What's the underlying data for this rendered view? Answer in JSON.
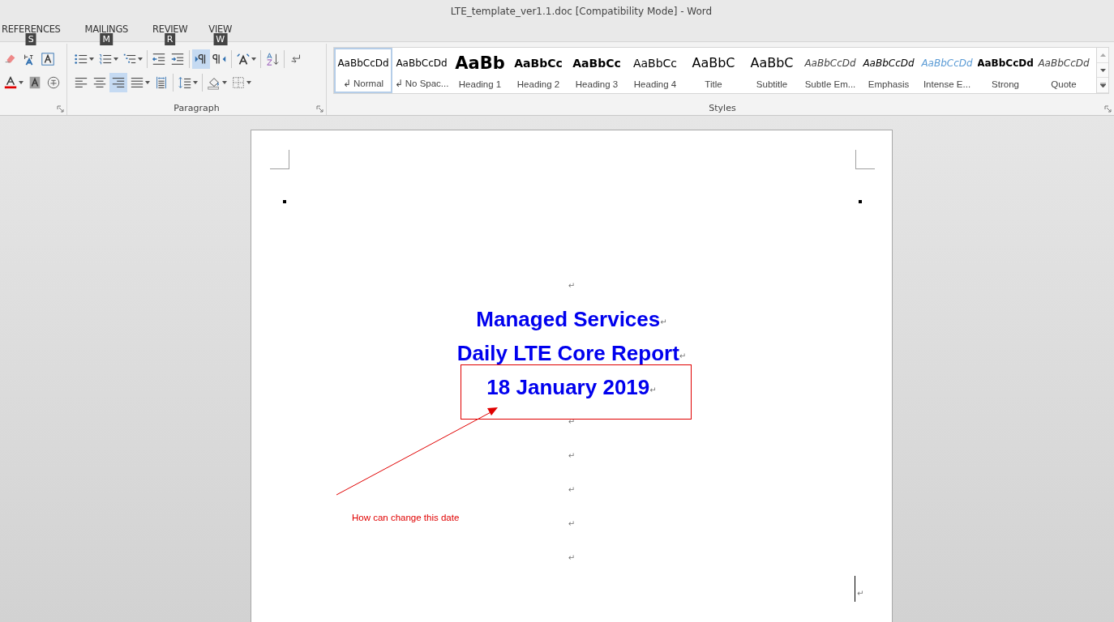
{
  "window": {
    "title": "LTE_template_ver1.1.doc [Compatibility Mode] - Word"
  },
  "tabs": [
    {
      "label": "REFERENCES",
      "keytip": "S"
    },
    {
      "label": "MAILINGS",
      "keytip": "M"
    },
    {
      "label": "REVIEW",
      "keytip": "R"
    },
    {
      "label": "VIEW",
      "keytip": "W"
    }
  ],
  "font_group": {
    "rows": [
      [
        {
          "kind": "clear-format",
          "selected": false,
          "caret": false
        },
        {
          "kind": "phonetic",
          "selected": false,
          "caret": false
        },
        {
          "kind": "char-border",
          "selected": false,
          "caret": false
        }
      ],
      [
        {
          "kind": "font-color",
          "selected": false,
          "caret": true
        },
        {
          "kind": "char-shading",
          "selected": false,
          "caret": false
        },
        {
          "kind": "enclose",
          "selected": false,
          "caret": false
        }
      ]
    ]
  },
  "paragraph_group": {
    "label": "Paragraph",
    "rows": [
      [
        {
          "kind": "bullets",
          "selected": false,
          "caret": true
        },
        {
          "kind": "numbering",
          "selected": false,
          "caret": true
        },
        {
          "kind": "multilevel",
          "selected": false,
          "caret": true
        },
        {
          "kind": "sep"
        },
        {
          "kind": "outdent",
          "selected": false,
          "caret": false
        },
        {
          "kind": "indent",
          "selected": false,
          "caret": false
        },
        {
          "kind": "sep"
        },
        {
          "kind": "ltr",
          "selected": true,
          "caret": false
        },
        {
          "kind": "rtl",
          "selected": false,
          "caret": false
        },
        {
          "kind": "sep"
        },
        {
          "kind": "asian-layout",
          "selected": false,
          "caret": true
        },
        {
          "kind": "sep"
        },
        {
          "kind": "sort",
          "selected": false,
          "caret": false
        },
        {
          "kind": "sep"
        },
        {
          "kind": "show-marks",
          "selected": false,
          "caret": false
        }
      ],
      [
        {
          "kind": "align-left",
          "selected": false,
          "caret": false
        },
        {
          "kind": "align-center",
          "selected": false,
          "caret": false
        },
        {
          "kind": "align-right",
          "selected": true,
          "caret": false
        },
        {
          "kind": "justify",
          "selected": false,
          "caret": true
        },
        {
          "kind": "distributed",
          "selected": false,
          "caret": false
        },
        {
          "kind": "sep"
        },
        {
          "kind": "line-spacing",
          "selected": false,
          "caret": true
        },
        {
          "kind": "sep"
        },
        {
          "kind": "shading",
          "selected": false,
          "caret": true
        },
        {
          "kind": "borders",
          "selected": false,
          "caret": true
        }
      ]
    ]
  },
  "styles_group": {
    "label": "Styles",
    "items": [
      {
        "preview": "AaBbCcDd",
        "label": "Normal",
        "mark": "↲",
        "kind": "normal",
        "selected": true
      },
      {
        "preview": "AaBbCcDd",
        "label": "No Spac...",
        "mark": "↲",
        "kind": "normal",
        "selected": false
      },
      {
        "preview": "AaBb",
        "label": "Heading 1",
        "kind": "h1",
        "selected": false
      },
      {
        "preview": "AaBbCc",
        "label": "Heading 2",
        "kind": "h2",
        "selected": false
      },
      {
        "preview": "AaBbCc",
        "label": "Heading 3",
        "kind": "h2",
        "selected": false
      },
      {
        "preview": "AaBbCc",
        "label": "Heading 4",
        "kind": "h4",
        "selected": false
      },
      {
        "preview": "AaBbC",
        "label": "Title",
        "kind": "title",
        "selected": false
      },
      {
        "preview": "AaBbC",
        "label": "Subtitle",
        "kind": "title",
        "selected": false
      },
      {
        "preview": "AaBbCcDd",
        "label": "Subtle Em...",
        "kind": "italic",
        "selected": false
      },
      {
        "preview": "AaBbCcDd",
        "label": "Emphasis",
        "kind": "italic-dark",
        "selected": false
      },
      {
        "preview": "AaBbCcDd",
        "label": "Intense E...",
        "kind": "italic-blue",
        "selected": false
      },
      {
        "preview": "AaBbCcDd",
        "label": "Strong",
        "kind": "strong",
        "selected": false
      },
      {
        "preview": "AaBbCcDd",
        "label": "Quote",
        "kind": "italic",
        "selected": false
      }
    ]
  },
  "document": {
    "paragraphs": [
      {
        "kind": "empty",
        "mark": "↵"
      },
      {
        "kind": "heading",
        "text": "Managed Services",
        "mark": "↵"
      },
      {
        "kind": "heading",
        "text": "Daily LTE Core Report",
        "mark": "↵"
      },
      {
        "kind": "heading",
        "text": "18 January 2019",
        "mark": "↵"
      },
      {
        "kind": "empty",
        "mark": "↵"
      },
      {
        "kind": "empty",
        "mark": "↵"
      },
      {
        "kind": "empty",
        "mark": "↵"
      },
      {
        "kind": "empty",
        "mark": "↵"
      },
      {
        "kind": "empty",
        "mark": "↵"
      }
    ],
    "cursor_mark": "↵",
    "annotation": {
      "note": "How can change this date"
    }
  }
}
